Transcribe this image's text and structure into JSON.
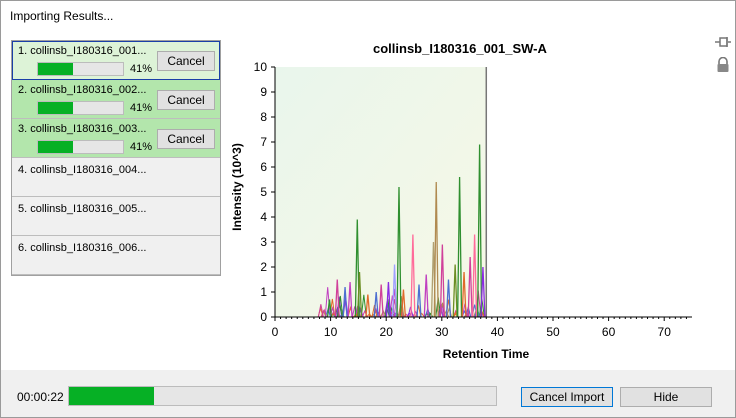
{
  "window": {
    "title": "Importing Results..."
  },
  "files": [
    {
      "label": "1. collinsb_I180316_001...",
      "percent": "41%",
      "progress": 0.41,
      "cancel_label": "Cancel",
      "state": "active"
    },
    {
      "label": "2. collinsb_I180316_002...",
      "percent": "41%",
      "progress": 0.41,
      "cancel_label": "Cancel",
      "state": "done"
    },
    {
      "label": "3. collinsb_I180316_003...",
      "percent": "41%",
      "progress": 0.41,
      "cancel_label": "Cancel",
      "state": "done"
    },
    {
      "label": "4. collinsb_I180316_004...",
      "state": "pending"
    },
    {
      "label": "5. collinsb_I180316_005...",
      "state": "pending"
    },
    {
      "label": "6. collinsb_I180316_006...",
      "state": "pending"
    }
  ],
  "icons": {
    "pin": "pin-icon",
    "lock": "lock-icon"
  },
  "colors": {
    "progress_green": "#06b025",
    "active_item": "#ddf3d7",
    "done_item": "#b3e6ac",
    "accent": "#0078d7"
  },
  "chart_data": {
    "type": "line",
    "title": "collinsb_I180316_001_SW-A",
    "xlabel": "Retention Time",
    "ylabel": "Intensity (10^3)",
    "xlim": [
      0,
      75
    ],
    "ylim": [
      0,
      10
    ],
    "xticks": [
      0,
      10,
      20,
      30,
      40,
      50,
      60,
      70
    ],
    "yticks": [
      0,
      1,
      2,
      3,
      4,
      5,
      6,
      7,
      8,
      9,
      10
    ],
    "progress_line_x": 38,
    "peaks": [
      {
        "x": 9.8,
        "y": 0.7,
        "color": "#2f8f2f"
      },
      {
        "x": 11.2,
        "y": 1.5,
        "color": "#d0409a"
      },
      {
        "x": 12.6,
        "y": 1.2,
        "color": "#4d6fd1"
      },
      {
        "x": 13.5,
        "y": 1.4,
        "color": "#c040c0"
      },
      {
        "x": 14.8,
        "y": 3.9,
        "color": "#2f8f2f"
      },
      {
        "x": 15.2,
        "y": 1.8,
        "color": "#6b8e23"
      },
      {
        "x": 16.7,
        "y": 0.9,
        "color": "#e06a2a"
      },
      {
        "x": 18.2,
        "y": 1.0,
        "color": "#4d6fd1"
      },
      {
        "x": 19.1,
        "y": 1.3,
        "color": "#d0409a"
      },
      {
        "x": 20.4,
        "y": 1.4,
        "color": "#8a2be2"
      },
      {
        "x": 21.5,
        "y": 2.1,
        "color": "#a0a0ff"
      },
      {
        "x": 22.3,
        "y": 5.2,
        "color": "#2f8f2f"
      },
      {
        "x": 23.1,
        "y": 1.1,
        "color": "#e06a2a"
      },
      {
        "x": 24.8,
        "y": 3.3,
        "color": "#ff6b9a"
      },
      {
        "x": 25.9,
        "y": 1.3,
        "color": "#4d6fd1"
      },
      {
        "x": 27.2,
        "y": 1.7,
        "color": "#c040c0"
      },
      {
        "x": 28.5,
        "y": 3.0,
        "color": "#b0a070"
      },
      {
        "x": 29.0,
        "y": 5.4,
        "color": "#b08a50"
      },
      {
        "x": 30.1,
        "y": 2.9,
        "color": "#d0409a"
      },
      {
        "x": 31.2,
        "y": 1.5,
        "color": "#4d6fd1"
      },
      {
        "x": 32.4,
        "y": 2.1,
        "color": "#6b8e23"
      },
      {
        "x": 33.2,
        "y": 5.6,
        "color": "#2f8f2f"
      },
      {
        "x": 34.0,
        "y": 1.8,
        "color": "#e06a2a"
      },
      {
        "x": 35.1,
        "y": 2.4,
        "color": "#d0409a"
      },
      {
        "x": 35.9,
        "y": 3.3,
        "color": "#ff6b9a"
      },
      {
        "x": 36.8,
        "y": 6.9,
        "color": "#2f8f2f"
      },
      {
        "x": 37.4,
        "y": 2.0,
        "color": "#8a2be2"
      }
    ]
  },
  "footer": {
    "elapsed": "00:00:22",
    "progress": 0.2,
    "cancel_import_label": "Cancel Import",
    "hide_label": "Hide"
  }
}
